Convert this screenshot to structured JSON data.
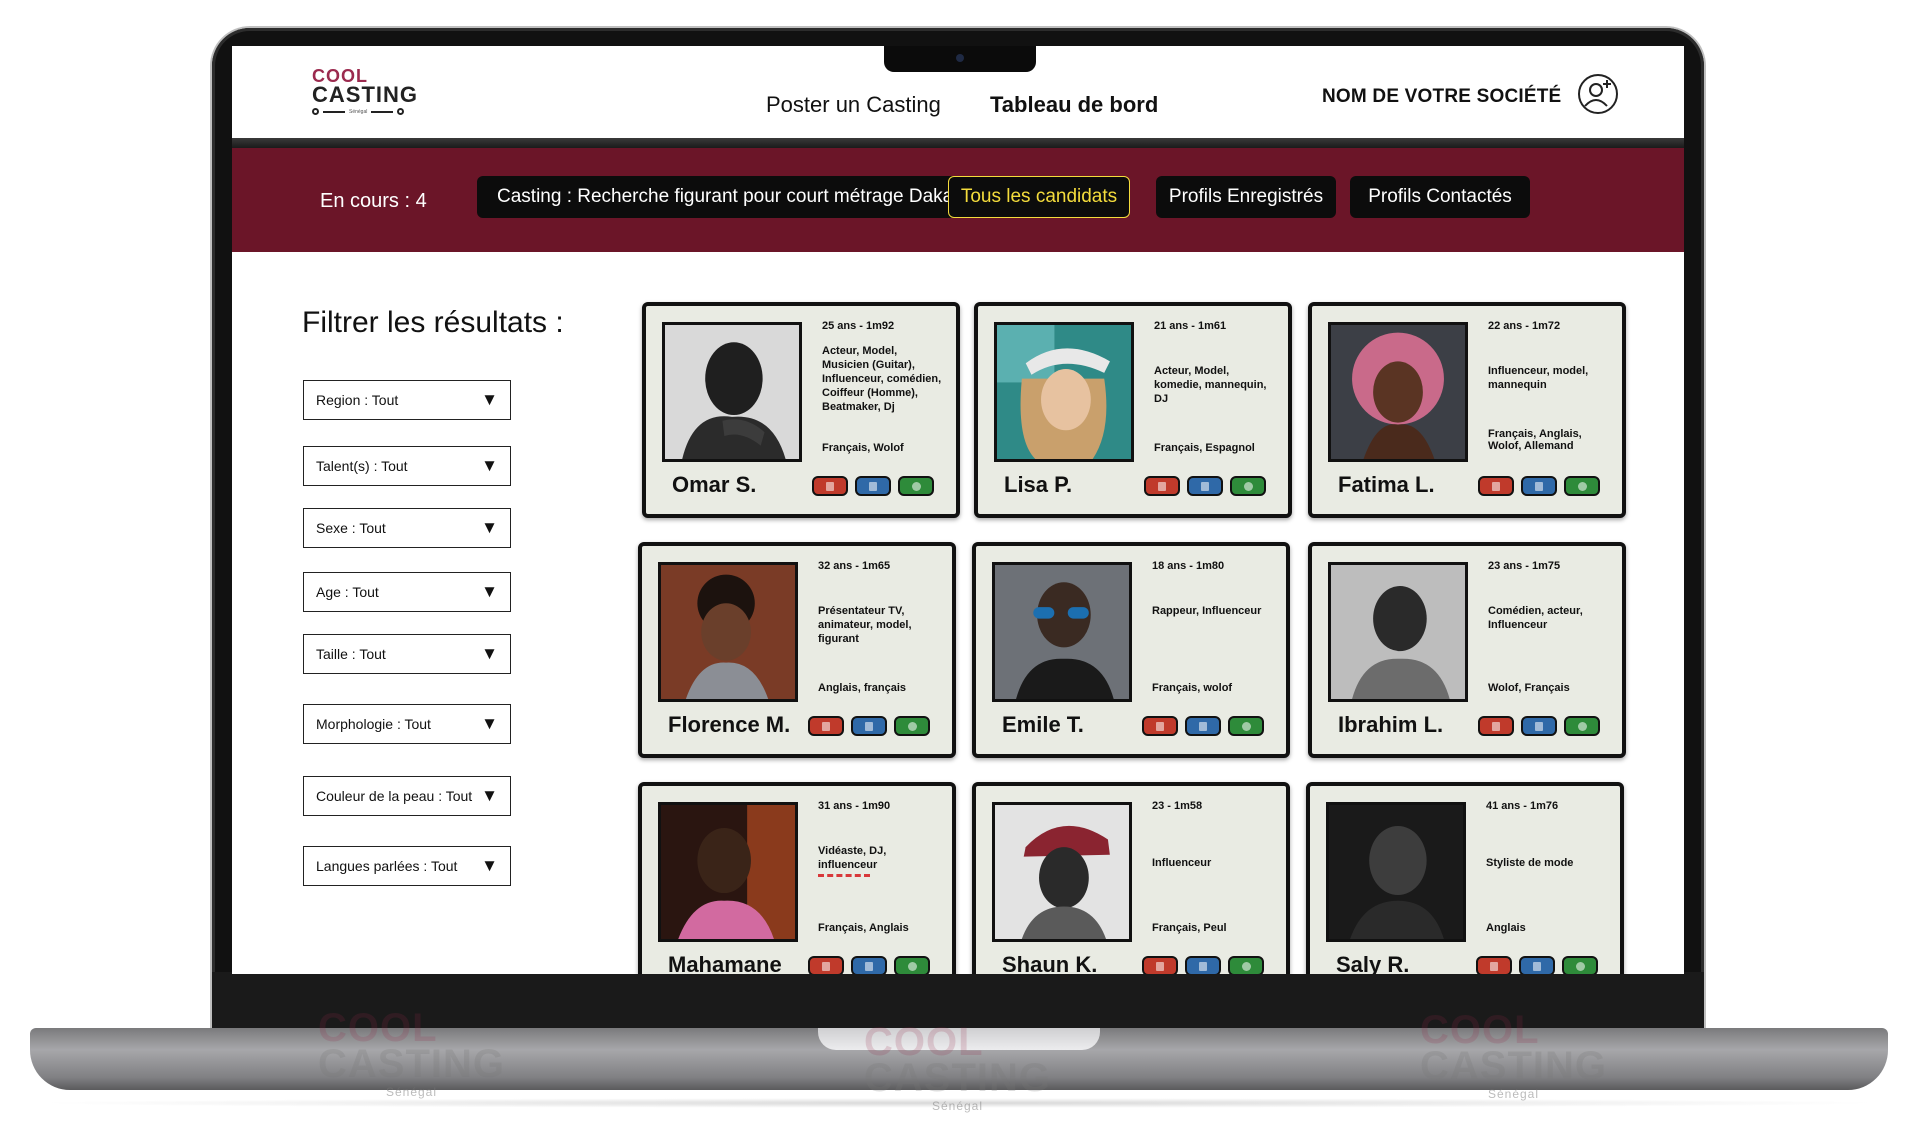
{
  "brand": {
    "top": "COOL",
    "bottom": "CASTING",
    "tagline": "Sénégal"
  },
  "nav": {
    "post_casting": "Poster un Casting",
    "dashboard": "Tableau de bord"
  },
  "company": "NOM DE VOTRE SOCIÉTÉ",
  "toolbar": {
    "en_cours": "En cours : 4",
    "casting": "Casting : Recherche figurant pour court métrage Dakar",
    "casting_arrow": "▼",
    "tabs": [
      "Tous les candidats",
      "Profils Enregistrés",
      "Profils Contactés"
    ]
  },
  "filters": {
    "title": "Filtrer les résultats :",
    "arrow": "▼",
    "items": [
      "Region : Tout",
      "Talent(s) : Tout",
      "Sexe : Tout",
      "Age : Tout",
      "Taille : Tout",
      "Morphologie : Tout",
      "Couleur de la peau : Tout",
      "Langues parlées : Tout"
    ]
  },
  "candidates": [
    {
      "name": "Omar S.",
      "meta": "25 ans - 1m92",
      "talent": "Acteur, Model, Musicien (Guitar), Influenceur, comédien, Coiffeur (Homme), Beatmaker, Dj",
      "languages": "Français, Wolof"
    },
    {
      "name": "Lisa P.",
      "meta": "21 ans - 1m61",
      "talent": "Acteur, Model, komedie, mannequin, DJ",
      "languages": "Français, Espagnol"
    },
    {
      "name": "Fatima L.",
      "meta": "22 ans - 1m72",
      "talent": "Influenceur, model, mannequin",
      "languages": "Français, Anglais, Wolof, Allemand"
    },
    {
      "name": "Florence M.",
      "meta": "32 ans - 1m65",
      "talent": "Présentateur TV, animateur, model, figurant",
      "languages": "Anglais, français"
    },
    {
      "name": "Emile T.",
      "meta": "18 ans - 1m80",
      "talent": "Rappeur, Influenceur",
      "languages": "Français, wolof"
    },
    {
      "name": "Ibrahim L.",
      "meta": "23 ans - 1m75",
      "talent": "Comédien, acteur, Influenceur",
      "languages": "Wolof, Français"
    },
    {
      "name": "Mahamane",
      "meta": "31 ans - 1m90",
      "talent": "Vidéaste, DJ, influenceur",
      "languages": "Français, Anglais"
    },
    {
      "name": "Shaun K.",
      "meta": "23 - 1m58",
      "talent": "Influenceur",
      "languages": "Français, Peul"
    },
    {
      "name": "Saly R.",
      "meta": "41 ans - 1m76",
      "talent": "Styliste de mode",
      "languages": "Anglais"
    }
  ],
  "colors": {
    "toolbar": "#6b1528",
    "active_tab": "#f4dc3c",
    "brand_accent": "#9b2a4e",
    "delete": "#c03a2b",
    "save": "#2f69a8",
    "contact": "#2e8b3a"
  },
  "icons": {
    "user": "user-plus-icon",
    "casting_dropdown": "chevron-down-icon",
    "delete": "trash-icon",
    "save": "save-icon",
    "contact": "whatsapp-icon"
  }
}
